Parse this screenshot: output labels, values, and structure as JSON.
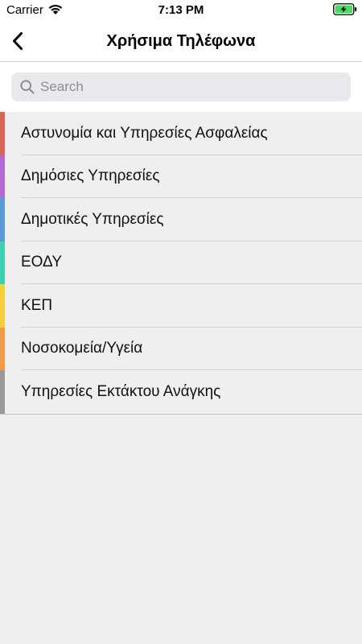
{
  "status_bar": {
    "carrier": "Carrier",
    "time": "7:13 PM",
    "wifi_icon": "wifi-icon",
    "battery_icon": "battery-charging-icon",
    "battery_color": "#4cd964"
  },
  "nav": {
    "title": "Χρήσιμα Τηλέφωνα",
    "back_icon": "chevron-left-icon"
  },
  "search": {
    "placeholder": "Search",
    "value": "",
    "icon": "search-icon"
  },
  "categories": [
    {
      "label": "Αστυνομία και Υπηρεσίες Ασφαλείας",
      "color": "#d9645a"
    },
    {
      "label": "Δημόσιες Υπηρεσίες",
      "color": "#b06ad1"
    },
    {
      "label": "Δημοτικές Υπηρεσίες",
      "color": "#5b9bd5"
    },
    {
      "label": "ΕΟΔΥ",
      "color": "#3fcfb4"
    },
    {
      "label": "ΚΕΠ",
      "color": "#f7cf3a"
    },
    {
      "label": "Νοσοκομεία/Υγεία",
      "color": "#f29a4a"
    },
    {
      "label": "Υπηρεσίες Εκτάκτου Ανάγκης",
      "color": "#979a9a"
    }
  ]
}
